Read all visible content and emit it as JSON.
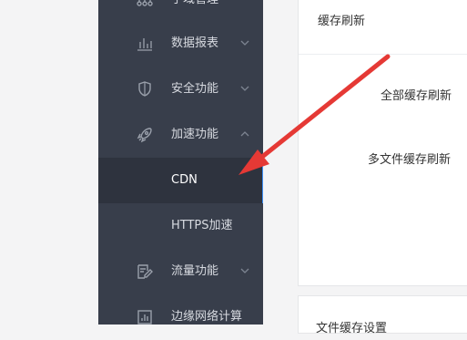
{
  "sidebar": {
    "items": [
      {
        "label": "子域管理",
        "icon": "network-icon"
      },
      {
        "label": "数据报表",
        "icon": "bar-chart-icon"
      },
      {
        "label": "安全功能",
        "icon": "shield-icon"
      },
      {
        "label": "加速功能",
        "icon": "rocket-icon"
      },
      {
        "label": "流量功能",
        "icon": "edit-icon"
      },
      {
        "label": "边缘网络计算",
        "icon": "analytics-icon"
      }
    ],
    "sub_items": [
      {
        "label": "CDN"
      },
      {
        "label": "HTTPS加速"
      }
    ],
    "active_color": "#3d8ff5",
    "background": "#383e4b"
  },
  "main": {
    "card_title": "缓存刷新",
    "rows": [
      {
        "label": "全部缓存刷新"
      },
      {
        "label": "多文件缓存刷新"
      }
    ],
    "card2_title": "文件缓存设置"
  },
  "annotation": {
    "arrow_color": "#e53935"
  }
}
